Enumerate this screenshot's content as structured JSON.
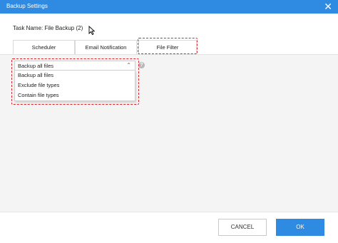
{
  "window": {
    "title": "Backup Settings",
    "close_glyph": "✕",
    "accent": "#2f8ae1"
  },
  "task_name": "Task Name: File Backup (2)",
  "tabs": [
    {
      "label": "Scheduler"
    },
    {
      "label": "Email Notification"
    },
    {
      "label": "File Filter"
    }
  ],
  "active_tab": "File Filter",
  "file_filter": {
    "selected": "Backup all files",
    "options": [
      {
        "label": "Backup all files"
      },
      {
        "label": "Exclude file types"
      },
      {
        "label": "Contain file types"
      }
    ],
    "help_glyph": "?"
  },
  "highlight_color": "#d9252b",
  "footer": {
    "cancel_label": "CANCEL",
    "ok_label": "OK"
  }
}
